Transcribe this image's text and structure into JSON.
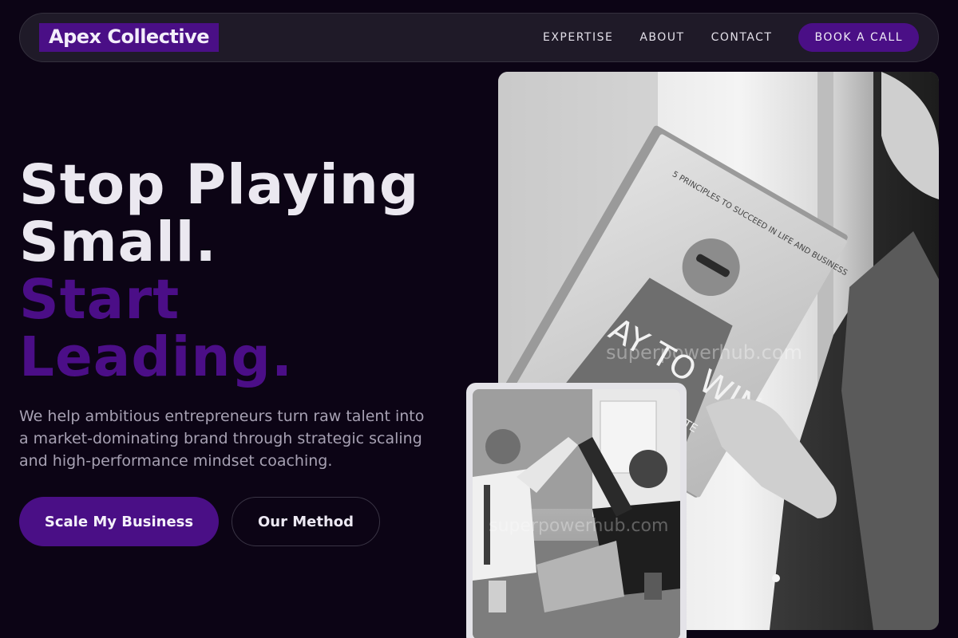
{
  "brand": {
    "logo_text": "Apex Collective"
  },
  "nav": {
    "links": [
      "EXPERTISE",
      "ABOUT",
      "CONTACT"
    ],
    "cta_label": "BOOK A CALL"
  },
  "hero": {
    "headline_line1": "Stop Playing",
    "headline_line2": "Small.",
    "headline_accent_line1": "Start",
    "headline_accent_line2": "Leading.",
    "subtext": "We help ambitious entrepreneurs turn raw talent into a market-dominating brand through strategic scaling and high-performance mindset coaching.",
    "primary_button": "Scale My Business",
    "secondary_button": "Our Method"
  },
  "images": {
    "book_title": "5 PRINCIPLES TO SUCCEED IN LIFE AND BUSINESS",
    "book_cover_letters": "AY TO WIN",
    "book_author": "WHITE",
    "watermark": "superpowerhub.com"
  },
  "colors": {
    "background": "#0c0415",
    "accent": "#4a0f86",
    "nav_bg": "#1f1a28"
  }
}
